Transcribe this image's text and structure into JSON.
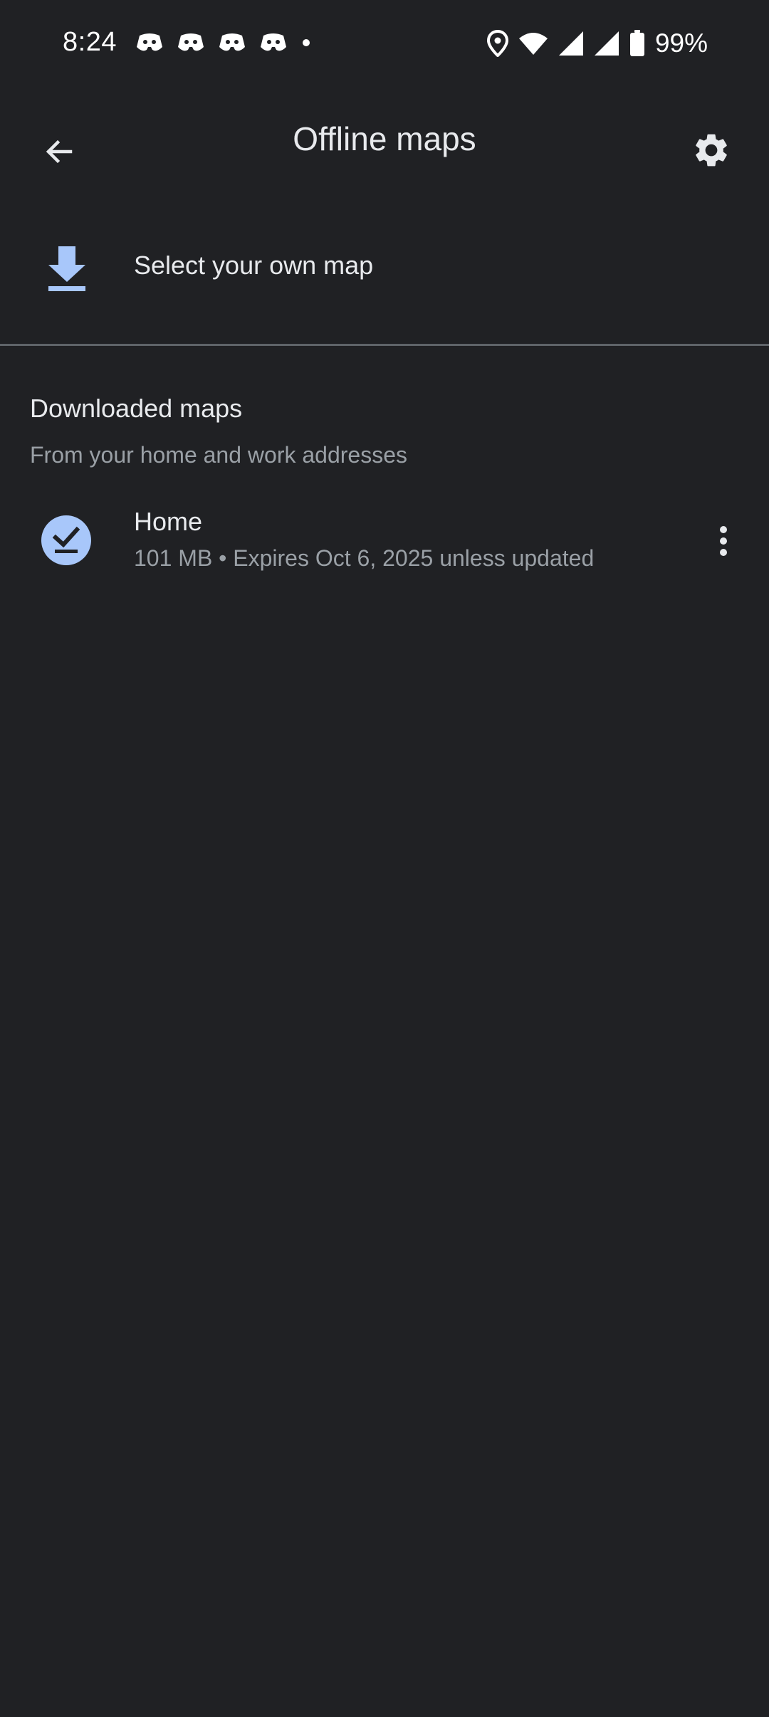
{
  "status_bar": {
    "time": "8:24",
    "battery": "99%",
    "icons": [
      "discord-icon",
      "discord-icon",
      "discord-icon",
      "discord-icon",
      "dot-icon",
      "location-icon",
      "wifi-icon",
      "signal-icon",
      "signal-icon",
      "battery-icon"
    ]
  },
  "app_bar": {
    "title": "Offline maps",
    "back_icon": "arrow-back-icon",
    "settings_icon": "gear-icon"
  },
  "select_map": {
    "label": "Select your own map",
    "icon": "download-icon"
  },
  "downloaded": {
    "title": "Downloaded maps",
    "subtitle": "From your home and work addresses",
    "items": [
      {
        "name": "Home",
        "meta": "101 MB • Expires Oct 6, 2025 unless updated",
        "icon": "check-download-icon"
      }
    ]
  },
  "colors": {
    "background": "#202124",
    "accent": "#a8c7fa",
    "text_primary": "#e8eaed",
    "text_secondary": "#9aa0a6",
    "divider": "#5f6368"
  }
}
